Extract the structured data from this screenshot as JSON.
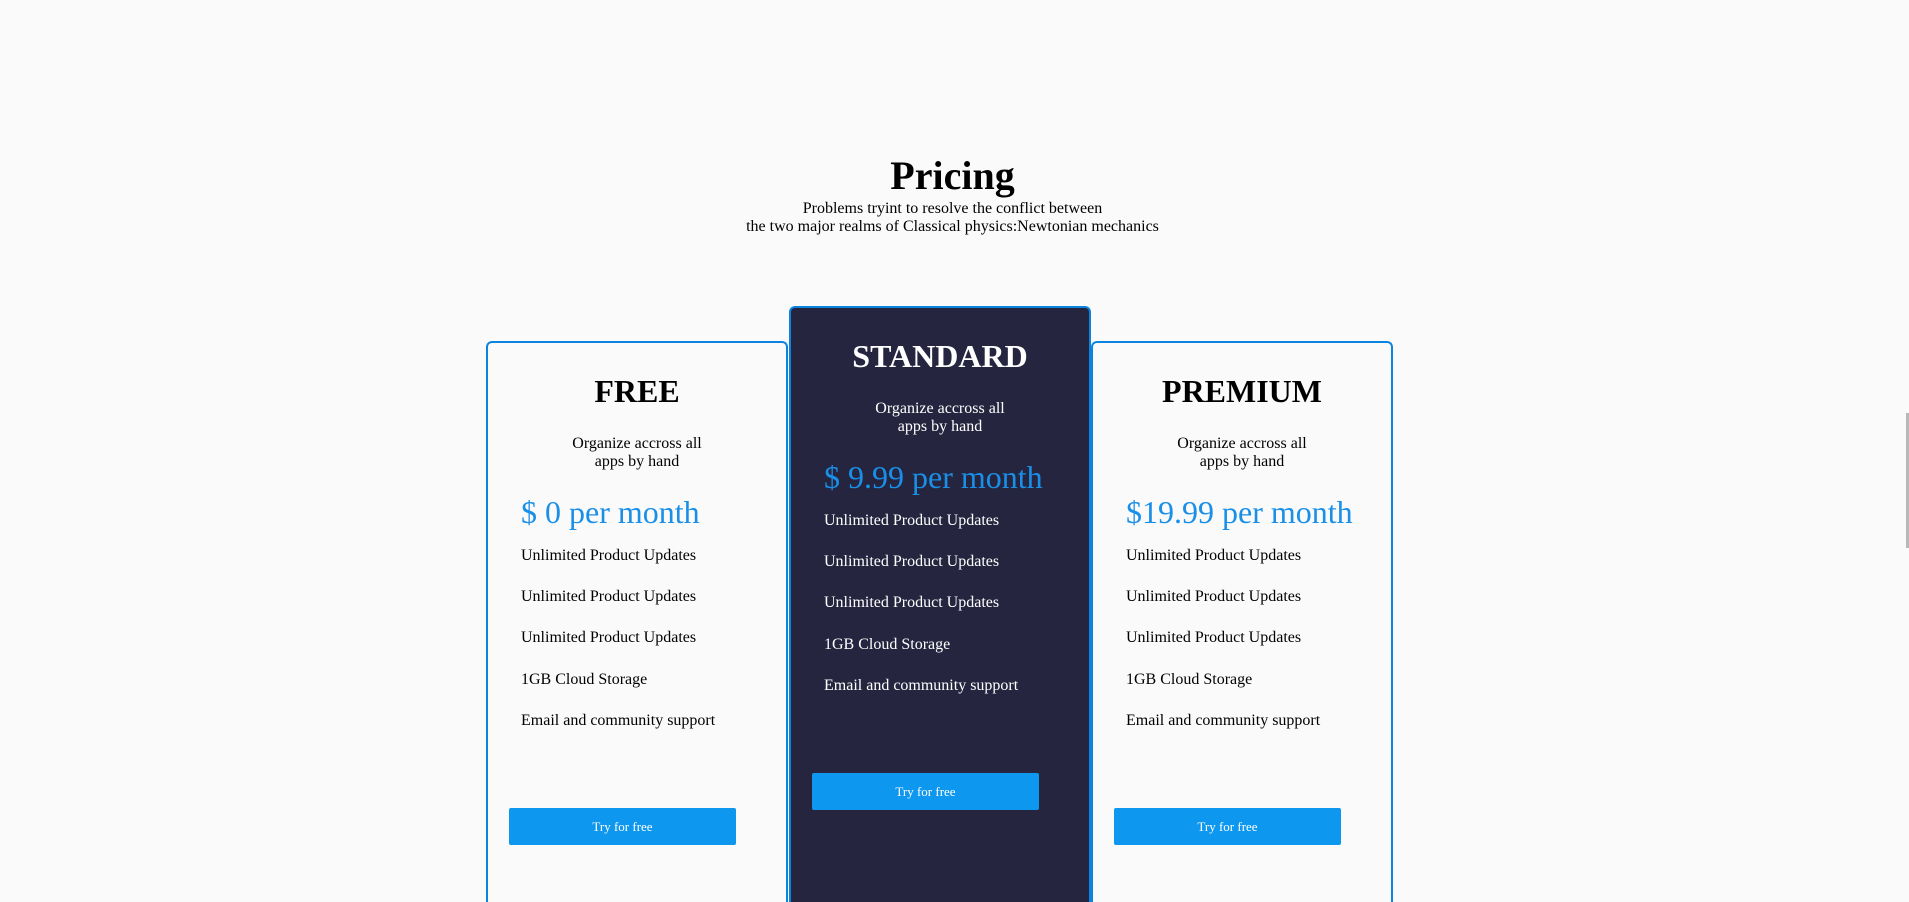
{
  "header": {
    "title": "Pricing",
    "subtitle_line1": "Problems tryint to resolve the conflict between",
    "subtitle_line2": "the two major realms of Classical physics:Newtonian mechanics"
  },
  "plans": [
    {
      "name": "FREE",
      "desc_line1": "Organize accross all",
      "desc_line2": "apps by hand",
      "price": "$ 0 per month",
      "features": [
        "Unlimited Product Updates",
        "Unlimited Product Updates",
        "Unlimited Product Updates",
        "1GB Cloud Storage",
        "Email and community support"
      ],
      "button_label": "Try for free"
    },
    {
      "name": "STANDARD",
      "desc_line1": "Organize accross all",
      "desc_line2": "apps by hand",
      "price": "$ 9.99 per month",
      "features": [
        "Unlimited Product Updates",
        "Unlimited Product Updates",
        "Unlimited Product Updates",
        "1GB Cloud Storage",
        "Email and community support"
      ],
      "button_label": "Try for free"
    },
    {
      "name": "PREMIUM",
      "desc_line1": "Organize accross all",
      "desc_line2": "apps by hand",
      "price": "$19.99 per month",
      "features": [
        "Unlimited Product Updates",
        "Unlimited Product Updates",
        "Unlimited Product Updates",
        "1GB Cloud Storage",
        "Email and community support"
      ],
      "button_label": "Try for free"
    }
  ],
  "colors": {
    "accent": "#0e97ef",
    "price": "#1a8fe8",
    "card_border": "#0b84e0",
    "featured_bg": "#252540",
    "page_bg": "#fafafa"
  }
}
